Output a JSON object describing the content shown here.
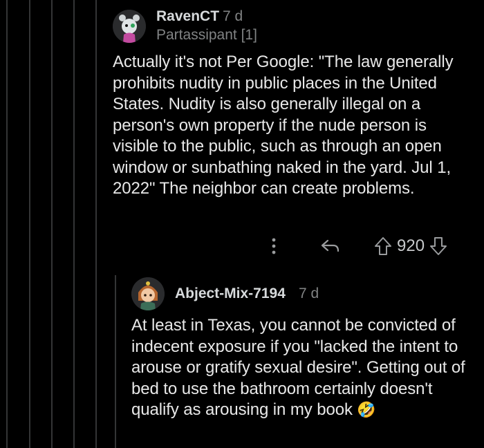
{
  "comments": [
    {
      "username": "RavenCT",
      "time": "7 d",
      "flair": "Partassipant [1]",
      "body": "Actually it's not Per Google: \"The law generally prohibits nudity in public places in the United States. Nudity is also generally illegal on a person's own property if the nude person is visible to the public, such as through an open window or sunbathing naked in the yard. Jul 1, 2022\" The neighbor can create problems.",
      "score": "920"
    },
    {
      "username": "Abject-Mix-7194",
      "time": "7 d",
      "body": "At least in Texas, you cannot be convicted of indecent exposure if you \"lacked the intent to arouse or gratify sexual desire\". Getting out of bed to use the bathroom certainly doesn't qualify as arousing in my book",
      "emoji": "🤣"
    }
  ],
  "icons": {
    "more": "more-options-icon",
    "reply": "reply-icon",
    "upvote": "upvote-icon",
    "downvote": "downvote-icon"
  },
  "colors": {
    "background": "#000000",
    "thread_line": "#343536",
    "text": "#e8e8e8",
    "meta": "#818384"
  }
}
